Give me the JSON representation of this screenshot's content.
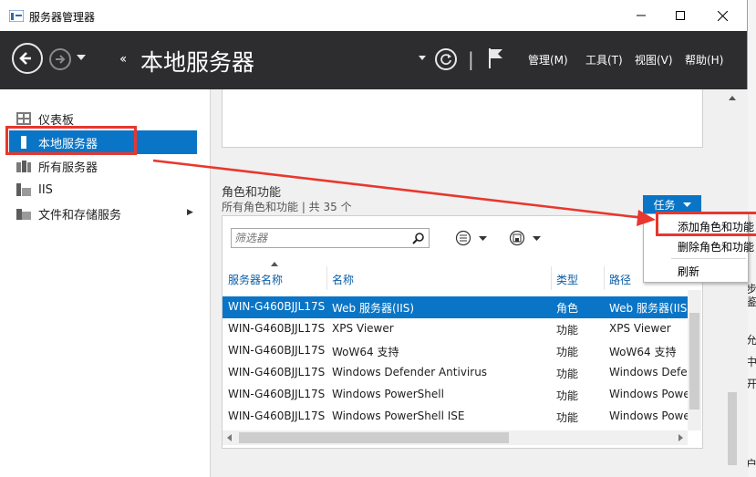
{
  "window": {
    "title": "服务器管理器"
  },
  "header": {
    "title": "本地服务器",
    "breadcrumb_arrows": "‹‹",
    "menu": [
      "管理(M)",
      "工具(T)",
      "视图(V)",
      "帮助(H)"
    ]
  },
  "sidebar": {
    "items": [
      {
        "label": "仪表板",
        "icon": "dashboard-icon"
      },
      {
        "label": "本地服务器",
        "icon": "server-icon",
        "selected": true
      },
      {
        "label": "所有服务器",
        "icon": "servers-icon"
      },
      {
        "label": "IIS",
        "icon": "iis-icon"
      },
      {
        "label": "文件和存储服务",
        "icon": "folder-icon",
        "has_submenu": true
      }
    ]
  },
  "roles": {
    "title": "角色和功能",
    "subtitle": "所有角色和功能 | 共 35 个",
    "tasks_label": "任务",
    "filter_placeholder": "筛选器",
    "columns": [
      "服务器名称",
      "名称",
      "类型",
      "路径"
    ],
    "rows": [
      [
        "WIN-G460BJJL17S",
        "Web 服务器(IIS)",
        "角色",
        "Web 服务器(IIS)"
      ],
      [
        "WIN-G460BJJL17S",
        "XPS Viewer",
        "功能",
        "XPS Viewer"
      ],
      [
        "WIN-G460BJJL17S",
        "WoW64 支持",
        "功能",
        "WoW64 支持"
      ],
      [
        "WIN-G460BJJL17S",
        "Windows Defender Antivirus",
        "功能",
        "Windows Defe"
      ],
      [
        "WIN-G460BJJL17S",
        "Windows PowerShell",
        "功能",
        "Windows Powe"
      ],
      [
        "WIN-G460BJJL17S",
        "Windows PowerShell ISE",
        "功能",
        "Windows Powe"
      ]
    ],
    "selected_row": 0
  },
  "tasks_menu": {
    "items": [
      "添加角色和功能",
      "删除角色和功能",
      "刷新"
    ]
  },
  "background_fragments": [
    "步",
    "鉴",
    "允",
    "中",
    "开",
    "户"
  ],
  "colors": {
    "accent": "#0a75c6",
    "header_bg": "#2d2d30",
    "annotation": "#e8372e"
  }
}
